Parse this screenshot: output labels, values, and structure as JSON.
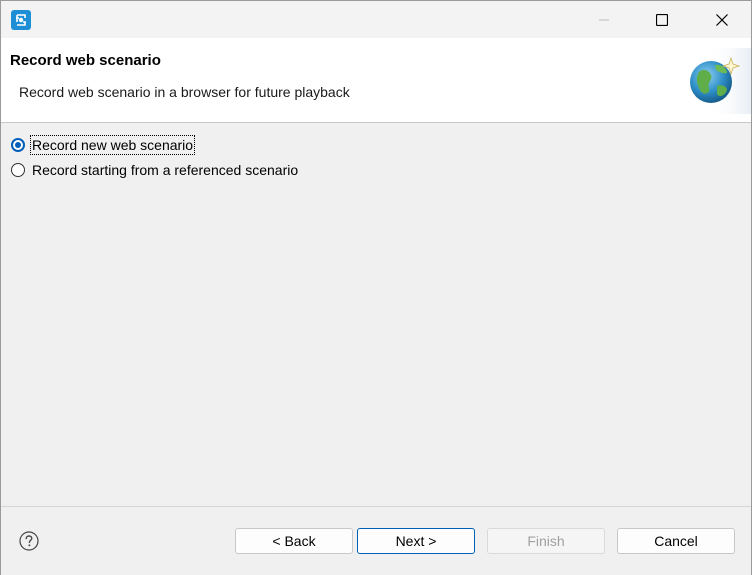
{
  "window": {
    "app_icon": "eclipse-app-icon",
    "controls": {
      "minimize_icon": "minimize-icon",
      "maximize_icon": "maximize-icon",
      "close_icon": "close-icon"
    }
  },
  "banner": {
    "title": "Record web scenario",
    "description": "Record web scenario in a browser for future playback",
    "image_icon": "globe-sparkle-icon"
  },
  "options": {
    "selected": "new",
    "items": [
      {
        "id": "new",
        "label": "Record new web scenario",
        "checked": true
      },
      {
        "id": "referenced",
        "label": "Record starting from a referenced scenario",
        "checked": false
      }
    ]
  },
  "footer": {
    "help_icon": "help-icon",
    "back_label": "< Back",
    "next_label": "Next >",
    "finish_label": "Finish",
    "cancel_label": "Cancel",
    "finish_enabled": false
  },
  "colors": {
    "accent": "#005fb8",
    "banner_bg": "#ffffff",
    "body_bg": "#f0f0f0",
    "disabled_text": "#a0a0a0"
  }
}
